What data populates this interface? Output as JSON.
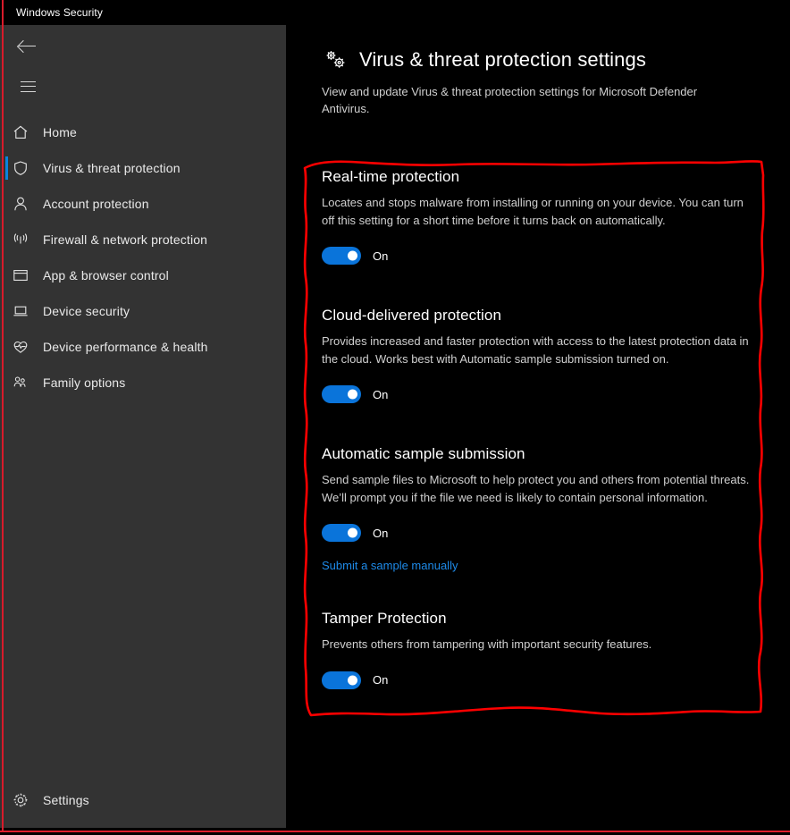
{
  "window": {
    "title": "Windows Security",
    "accent_color": "#0a74da",
    "link_color": "#1e8ae8",
    "annotation_color": "#ff0000",
    "sidebar_bg": "#333333",
    "content_bg": "#000000"
  },
  "sidebar": {
    "back_icon": "back-arrow-icon",
    "menu_icon": "hamburger-icon",
    "items": [
      {
        "label": "Home",
        "icon": "home-icon",
        "selected": false
      },
      {
        "label": "Virus & threat protection",
        "icon": "shield-icon",
        "selected": true
      },
      {
        "label": "Account protection",
        "icon": "person-icon",
        "selected": false
      },
      {
        "label": "Firewall & network protection",
        "icon": "wifi-icon",
        "selected": false
      },
      {
        "label": "App & browser control",
        "icon": "window-icon",
        "selected": false
      },
      {
        "label": "Device security",
        "icon": "laptop-icon",
        "selected": false
      },
      {
        "label": "Device performance & health",
        "icon": "heart-pulse-icon",
        "selected": false
      },
      {
        "label": "Family options",
        "icon": "family-icon",
        "selected": false
      }
    ],
    "settings": {
      "label": "Settings",
      "icon": "gear-icon"
    }
  },
  "main": {
    "header_icon": "gears-icon",
    "title": "Virus & threat protection settings",
    "subtitle": "View and update Virus & threat protection settings for Microsoft Defender Antivirus.",
    "sections": [
      {
        "title": "Real-time protection",
        "description": "Locates and stops malware from installing or running on your device. You can turn off this setting for a short time before it turns back on automatically.",
        "toggle_state": "On",
        "toggle_on": true
      },
      {
        "title": "Cloud-delivered protection",
        "description": "Provides increased and faster protection with access to the latest protection data in the cloud. Works best with Automatic sample submission turned on.",
        "toggle_state": "On",
        "toggle_on": true
      },
      {
        "title": "Automatic sample submission",
        "description": "Send sample files to Microsoft to help protect you and others from potential threats. We’ll prompt you if the file we need is likely to contain personal information.",
        "toggle_state": "On",
        "toggle_on": true,
        "link": "Submit a sample manually"
      },
      {
        "title": "Tamper Protection",
        "description": "Prevents others from tampering with important security features.",
        "toggle_state": "On",
        "toggle_on": true
      }
    ]
  }
}
